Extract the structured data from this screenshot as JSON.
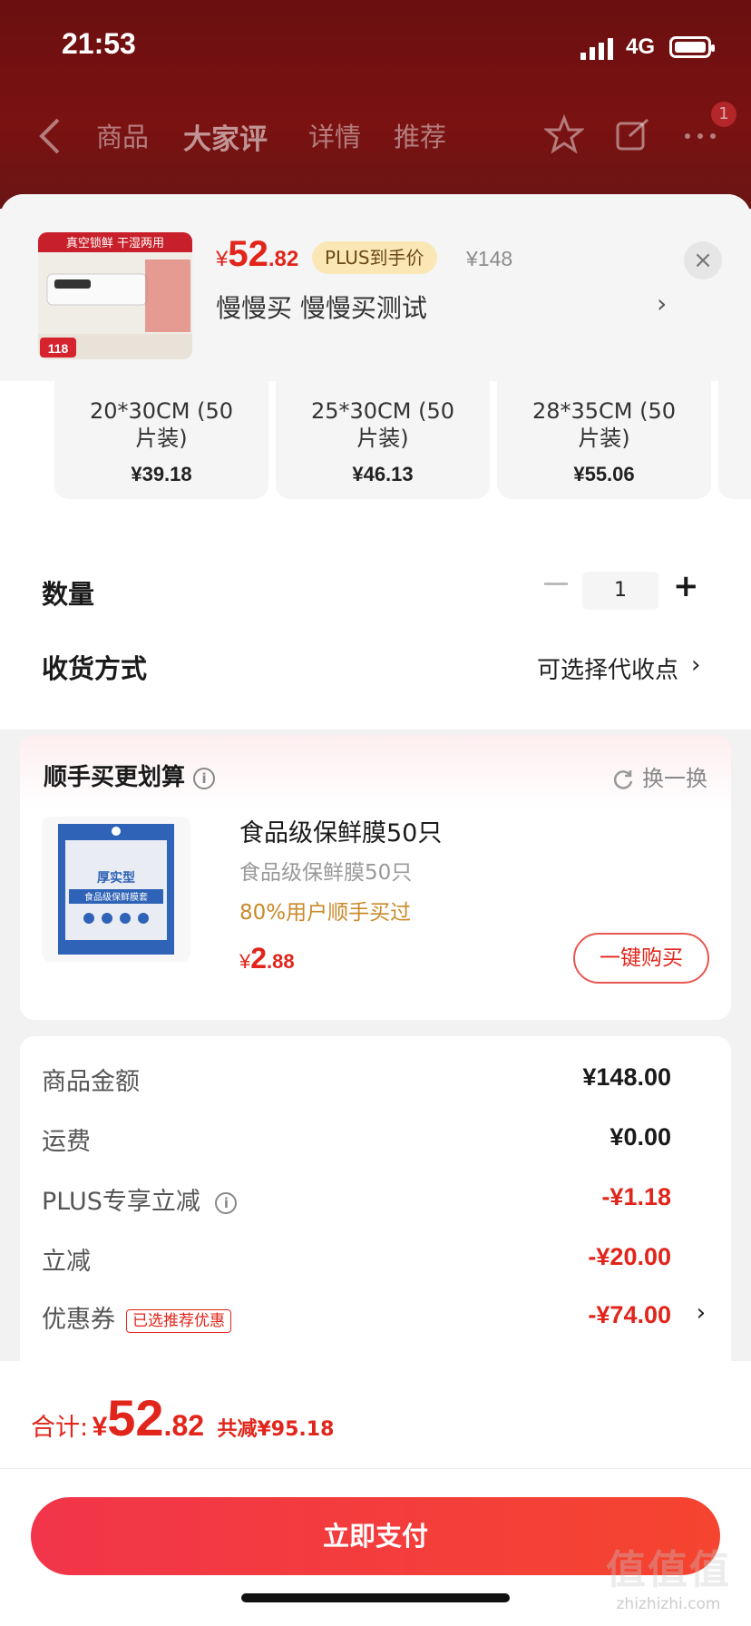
{
  "status_bar": {
    "time": "21:53",
    "network": "4G"
  },
  "nav": {
    "tabs": [
      {
        "label": "商品"
      },
      {
        "label": "大家评"
      },
      {
        "label": "详情"
      },
      {
        "label": "推荐"
      }
    ],
    "badge_count": "1"
  },
  "product": {
    "image_caption": "真空锁鲜 干湿两用",
    "image_price": "118",
    "price_symbol": "¥",
    "price_int": "52",
    "price_dec": ".82",
    "plus_tag": "PLUS到手价",
    "original_price": "¥148",
    "spec": "慢慢买  慢慢买测试",
    "spec_arrow": "›",
    "close": "×"
  },
  "sizes": [
    {
      "name_line1": "20*30CM (50",
      "name_line2": "片装)",
      "price": "¥39.18"
    },
    {
      "name_line1": "25*30CM (50",
      "name_line2": "片装)",
      "price": "¥46.13"
    },
    {
      "name_line1": "28*35CM (50",
      "name_line2": "片装)",
      "price": "¥55.06"
    }
  ],
  "quantity": {
    "label": "数量",
    "value": "1",
    "minus": "−",
    "plus": "+"
  },
  "shipping": {
    "label": "收货方式",
    "value": "可选择代收点",
    "arrow": "›"
  },
  "addon": {
    "title": "顺手买更划算",
    "info": "i",
    "refresh": "换一换",
    "name": "食品级保鲜膜50只",
    "subtitle": "食品级保鲜膜50只",
    "bought_pct": "80%用户顺手买过",
    "price_symbol": "¥",
    "price_int": "2",
    "price_dec": ".88",
    "buy_label": "一键购买",
    "img_text1": "厚实型",
    "img_text2": "食品级保鲜膜套"
  },
  "summary": {
    "rows": [
      {
        "label": "商品金额",
        "value": "¥148.00"
      },
      {
        "label": "运费",
        "value": "¥0.00"
      },
      {
        "label": "PLUS专享立减",
        "value": "-¥1.18"
      },
      {
        "label": "立减",
        "value": "-¥20.00"
      },
      {
        "label": "优惠券",
        "tag": "已选推荐优惠",
        "value": "-¥74.00"
      }
    ],
    "arrow": "›"
  },
  "footer": {
    "total_label": "合计:",
    "total_symbol": "¥",
    "total_int": "52",
    "total_dec": ".82",
    "saved": "共减¥95.18",
    "pay_label": "立即支付",
    "watermark": "值值值",
    "watermark_url": "zhizhizhi.com"
  },
  "colors": {
    "accent": "#e1251b",
    "pay_button": "#f2354a",
    "plus_tag_bg": "#fbe7b5"
  }
}
